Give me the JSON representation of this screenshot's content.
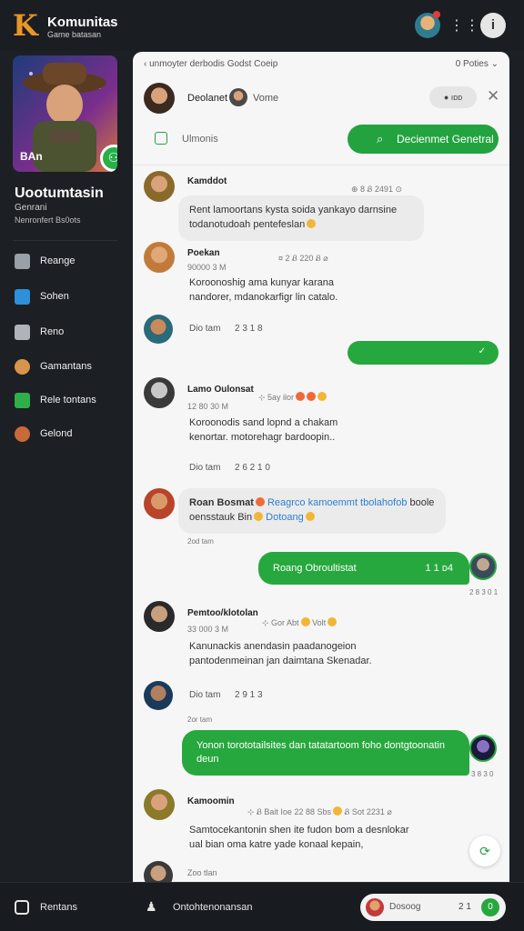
{
  "app": {
    "logo": "K",
    "title": "Komunitas",
    "subtitle": "Game batasan"
  },
  "sidebar": {
    "card_label": "BAn",
    "game_title": "Uootumtasin",
    "game_sub1": "Genrani",
    "game_sub2": "Nenronfert Bs0ots",
    "items": [
      {
        "label": "Reange",
        "icon": "list-icon",
        "color": "#9aa0a8"
      },
      {
        "label": "Sohen",
        "icon": "calendar-icon",
        "color": "#2f8fd8"
      },
      {
        "label": "Reno",
        "icon": "image-icon",
        "color": "#b0b4ba"
      },
      {
        "label": "Gamantans",
        "icon": "avatar-icon",
        "color": "#d8944a"
      },
      {
        "label": "Rele tontans",
        "icon": "store-icon",
        "color": "#2fae4a"
      },
      {
        "label": "Gelond",
        "icon": "avatar-icon",
        "color": "#c86a3a"
      }
    ]
  },
  "chat": {
    "crumb": "unmoyter derbodis Godst Coeip",
    "crumb_right": "0 Poties ⌄",
    "header_name": "Deolanet",
    "header_name2": "Vome",
    "header_pill": "● ıᴅᴅ",
    "search_hint": "Ulmonis",
    "search_button": "Decienmet Genetral",
    "messages": [
      {
        "name": "Kamddot",
        "meta": "⊕ 8  Ᏸ 2491 ⊙",
        "lines": [
          "Rent lamoortans kysta soida yankayo darnsine",
          "todanotudoah pentefeslan"
        ]
      },
      {
        "name": "Poekan",
        "meta": "¤ 2 Ᏸ 220  Ᏸ ⌀",
        "sub": "90000 3 M",
        "lines": [
          "Koroonoshig ama kunyar karana",
          "nandorer, mdanokarfigr lin catalo."
        ]
      },
      {
        "name": "Lamo Oulonsat",
        "meta": "⊹ 5ay  ilor",
        "sub": "12 80 30 M",
        "lines": [
          "Koroonodis sand lopnd a chakam",
          "kenortar. motorehagr bardoopin.."
        ]
      },
      {
        "name": "Roan Bosmat",
        "inline": "Reagrco kamoemmt tbolahofob",
        "inline2": "boole",
        "lines": [
          "oensstauk Bin",
          "Dotoang"
        ]
      },
      {
        "name": "Pemtoo/klotolan",
        "meta": "⊹ Gor Abt",
        "meta2": "Volt",
        "sub": "33 000 3 M",
        "lines": [
          "Kanunackis anendasin paadanogeion",
          "pantodenmeinan jan daimtana Skenadar."
        ]
      },
      {
        "name": "Kamoomin",
        "meta": "⊹ Ᏸ Bait Ioe 22 88 Sbs",
        "meta2": "Ᏸ Sot 2231 ⌀",
        "lines": [
          "Samtocekantonin shen ite fudon bom a desnlokar",
          "ual bian oma katre yade konaal kepain,"
        ]
      }
    ],
    "sys1": {
      "label": "Dio tam",
      "value": "2 3 1 8"
    },
    "sys2": {
      "label": "Dio tam",
      "value": "2 6 2 1 0"
    },
    "sys3": {
      "label": "Dio tam",
      "value": "2 9 1 3"
    },
    "sys4": "2od tam",
    "sys5": "2or tam",
    "sys6": "Zoo tlan",
    "sent1": {
      "text": "",
      "check": "✓"
    },
    "sent2": {
      "text": "Roang Obroultistat",
      "right": "1 1  ᴅ4",
      "ts": "2 8  3 0 1"
    },
    "sent3": {
      "lines": [
        "Yonon torototailsites dan tatatartoom foho dontgtoonatin",
        "deun"
      ],
      "ts": "3 8  3 0"
    }
  },
  "bottombar": {
    "left_label": "Rentans",
    "mid_label": "Ontohtenonansan",
    "pill_label": "Dosoog",
    "pill_num": "2 1",
    "pill_btn": "0"
  }
}
